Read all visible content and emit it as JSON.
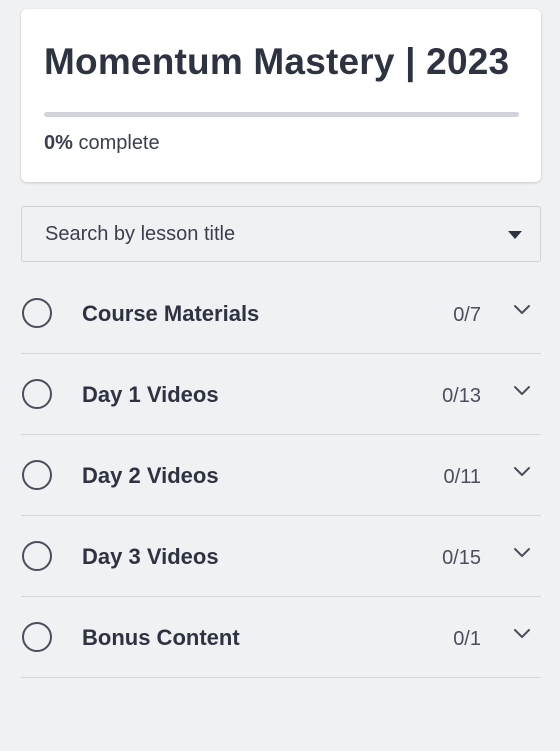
{
  "course": {
    "title": "Momentum Mastery | 2023",
    "progress_percent": 0,
    "progress_value": "0%",
    "progress_suffix": " complete"
  },
  "search": {
    "placeholder": "Search by lesson title"
  },
  "sections": [
    {
      "title": "Course Materials",
      "count": "0/7"
    },
    {
      "title": "Day 1 Videos",
      "count": "0/13"
    },
    {
      "title": "Day 2 Videos",
      "count": "0/11"
    },
    {
      "title": "Day 3 Videos",
      "count": "0/15"
    },
    {
      "title": "Bonus Content",
      "count": "0/1"
    }
  ],
  "colors": {
    "background": "#f0f1f3",
    "card": "#ffffff",
    "text": "#2e3342",
    "progress_track": "#d0d3dc"
  }
}
